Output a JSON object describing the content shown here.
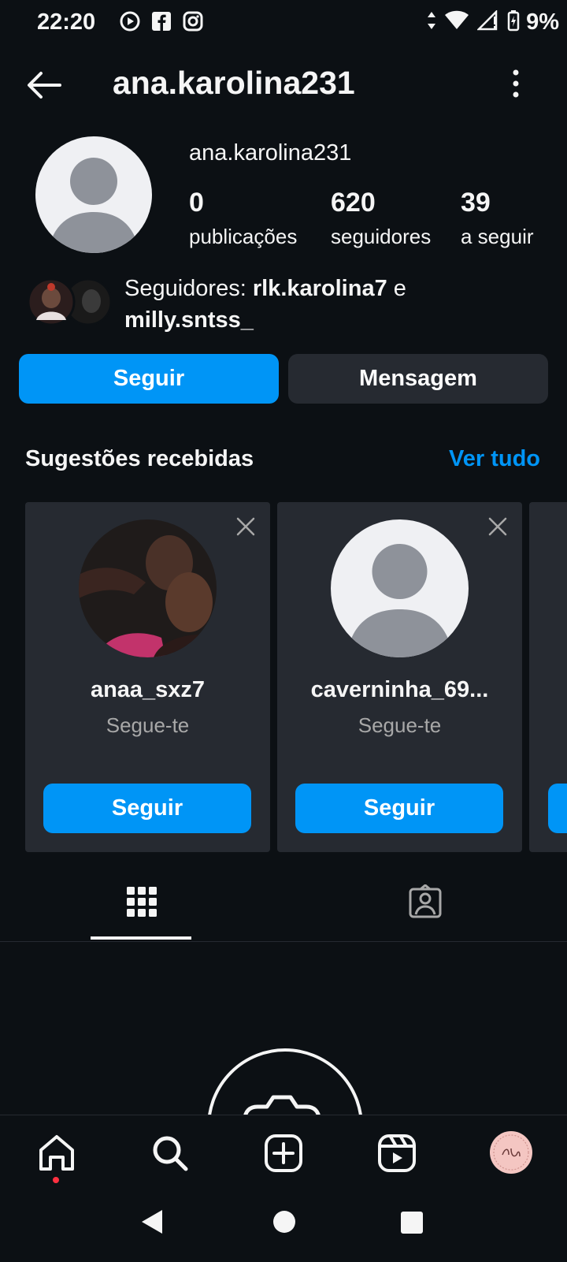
{
  "status_bar": {
    "time": "22:20",
    "battery": "9%",
    "left_icons": [
      "youtube-icon",
      "facebook-icon",
      "instagram-icon"
    ],
    "right_icons": [
      "data-arrows-icon",
      "wifi-icon",
      "signal-icon",
      "battery-charging-icon"
    ]
  },
  "header": {
    "title": "ana.karolina231"
  },
  "profile": {
    "username": "ana.karolina231",
    "stats": [
      {
        "value": "0",
        "label": "publicações"
      },
      {
        "value": "620",
        "label": "seguidores"
      },
      {
        "value": "39",
        "label": "a seguir"
      }
    ],
    "mutual": {
      "prefix": "Seguidores:",
      "user1": "rlk.karolina7",
      "conj": "e",
      "user2": "milly.sntss_"
    }
  },
  "actions": {
    "follow": "Seguir",
    "message": "Mensagem"
  },
  "suggestions": {
    "title": "Sugestões recebidas",
    "see_all": "Ver tudo",
    "cards": [
      {
        "name": "anaa_sxz7",
        "subtitle": "Segue-te",
        "button": "Seguir"
      },
      {
        "name": "caverninha_69...",
        "subtitle": "Segue-te",
        "button": "Seguir"
      }
    ]
  },
  "tabs": [
    "grid-icon",
    "tagged-icon"
  ],
  "bottom_nav": [
    "home-icon",
    "search-icon",
    "create-icon",
    "reels-icon",
    "profile-avatar-icon"
  ],
  "colors": {
    "accent": "#0095f6",
    "background": "#0c1014",
    "card": "#262a31",
    "notification_dot": "#ff3040"
  }
}
